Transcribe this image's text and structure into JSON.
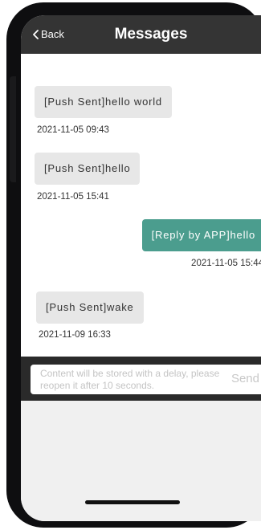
{
  "header": {
    "back_label": "Back",
    "title": "Messages"
  },
  "messages": [
    {
      "direction": "incoming",
      "text": "[Push Sent]hello world",
      "time": "2021-11-05 09:43"
    },
    {
      "direction": "incoming",
      "text": "[Push Sent]hello",
      "time": "2021-11-05 15:41"
    },
    {
      "direction": "outgoing",
      "text": "[Reply by APP]hello",
      "time": "2021-11-05 15:44"
    },
    {
      "direction": "incoming",
      "text": "[Push Sent]wake",
      "time": "2021-11-09 16:33"
    }
  ],
  "composer": {
    "placeholder": "Content will be stored with a delay, please reopen it after 10 seconds.",
    "send_label": "Send"
  },
  "colors": {
    "navbar": "#343434",
    "incoming_bubble": "#e7e7e7",
    "outgoing_bubble": "#4b9d8e",
    "composer_bar": "#2a2a2a",
    "background": "#f0f0f0"
  },
  "icons": {
    "back": "chevron-left-icon"
  }
}
